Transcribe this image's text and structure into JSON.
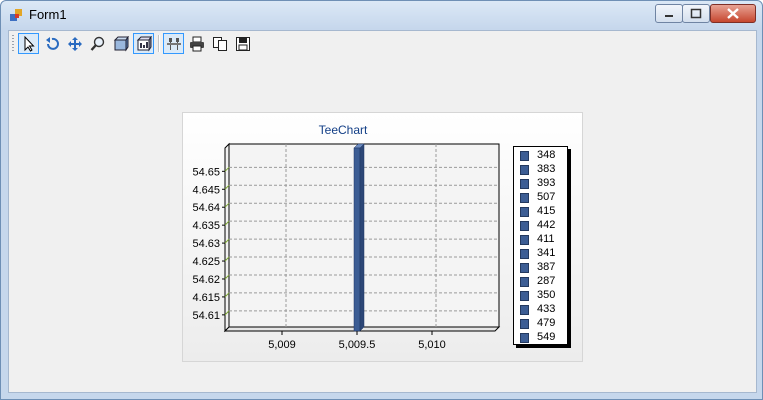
{
  "window": {
    "title": "Form1"
  },
  "toolbar": {
    "buttons": [
      {
        "icon": "pointer-icon",
        "checked": true
      },
      {
        "icon": "undo-icon",
        "checked": false
      },
      {
        "icon": "move-icon",
        "checked": false
      },
      {
        "icon": "zoom-icon",
        "checked": false
      },
      {
        "icon": "rotate-3d-icon",
        "checked": false
      },
      {
        "icon": "3d-view-icon",
        "checked": true
      },
      {
        "icon": "edit-chart-icon",
        "checked": true
      },
      {
        "icon": "print-icon",
        "checked": false
      },
      {
        "icon": "copy-icon",
        "checked": false
      },
      {
        "icon": "save-icon",
        "checked": false
      }
    ]
  },
  "chart_data": {
    "type": "bar",
    "title": "TeeChart",
    "xlabel": "",
    "ylabel": "",
    "x_ticks": [
      "5,009",
      "5,009.5",
      "5,010"
    ],
    "y_ticks": [
      "54.61",
      "4.615",
      "54.62",
      "4.625",
      "54.63",
      "4.635",
      "54.64",
      "4.645",
      "54.65"
    ],
    "xlim": [
      5008.62,
      5010.42
    ],
    "ylim": [
      54.6055,
      54.6565
    ],
    "grid": true,
    "bar": {
      "x": 5009.5,
      "width": 0.04,
      "color": "#3c5d94"
    },
    "legend_position": "right",
    "legend": [
      "348",
      "383",
      "393",
      "507",
      "415",
      "442",
      "411",
      "341",
      "387",
      "287",
      "350",
      "433",
      "479",
      "549"
    ]
  }
}
